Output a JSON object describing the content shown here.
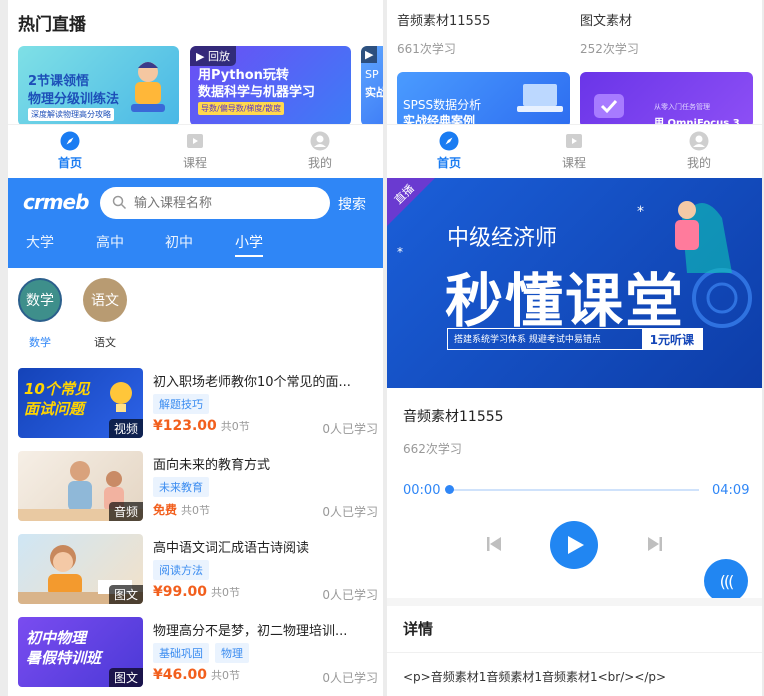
{
  "live": {
    "title": "热门直播",
    "card1": {
      "line1": "2节课领悟",
      "line2": "物理分级训练法",
      "sub": "深度解读物理高分攻略"
    },
    "card2": {
      "badge": "回放",
      "line1": "用Python玩转",
      "line2": "数据科学与机器学习",
      "sub": "导数/偏导数/梯度/散度"
    },
    "card3": {
      "line1": "SP",
      "line2": "实战"
    }
  },
  "tabs": {
    "home": "首页",
    "course": "课程",
    "mine": "我的"
  },
  "audio_list": {
    "items": [
      {
        "title": "音频素材11555",
        "count": "661次学习",
        "thumb_line1": "SPSS数据分析",
        "thumb_line2": "实战经典案例"
      },
      {
        "title": "图文素材",
        "count": "252次学习",
        "thumb_line1": "从零入门任务管理",
        "thumb_line2": "用 OmniFocus 3"
      }
    ]
  },
  "header": {
    "logo": "crmeb",
    "search_placeholder": "输入课程名称",
    "search_button": "搜索",
    "categories": [
      "大学",
      "高中",
      "初中",
      "小学"
    ],
    "active_category": "小学"
  },
  "subjects": [
    {
      "label": "数学",
      "circle": "数学",
      "color": "#3e8f8b"
    },
    {
      "label": "语文",
      "circle": "语文",
      "color": "#b89b72"
    }
  ],
  "courses": [
    {
      "title": "初入职场老师教你10个常见的面...",
      "tags": [
        "解题技巧"
      ],
      "price": "¥123.00",
      "sections": "共0节",
      "learners": "0人已学习",
      "badge": "视频",
      "thumb_line1": "10个常见",
      "thumb_line2": "面试问题"
    },
    {
      "title": "面向未来的教育方式",
      "tags": [
        "未来教育"
      ],
      "price": "免费",
      "sections": "共0节",
      "learners": "0人已学习",
      "badge": "音频"
    },
    {
      "title": "高中语文词汇成语古诗阅读",
      "tags": [
        "阅读方法"
      ],
      "price": "¥99.00",
      "sections": "共0节",
      "learners": "0人已学习",
      "badge": "图文"
    },
    {
      "title": "物理高分不是梦，初二物理培训...",
      "tags": [
        "基础巩固",
        "物理"
      ],
      "price": "¥46.00",
      "sections": "共0节",
      "learners": "0人已学习",
      "badge": "图文",
      "thumb_line1": "初中物理",
      "thumb_line2": "暑假特训班"
    }
  ],
  "player": {
    "banner": {
      "corner": "直播",
      "line1": "中级经济师",
      "line2": "秒懂课堂",
      "strip": "搭建系统学习体系  规避考试中易错点",
      "cta": "1元听课"
    },
    "title": "音频素材11555",
    "count": "662次学习",
    "current_time": "00:00",
    "duration": "04:09",
    "fab": "(((",
    "detail_heading": "详情",
    "detail_body": "<p>音频素材1音频素材1音频素材1<br/></p>"
  }
}
